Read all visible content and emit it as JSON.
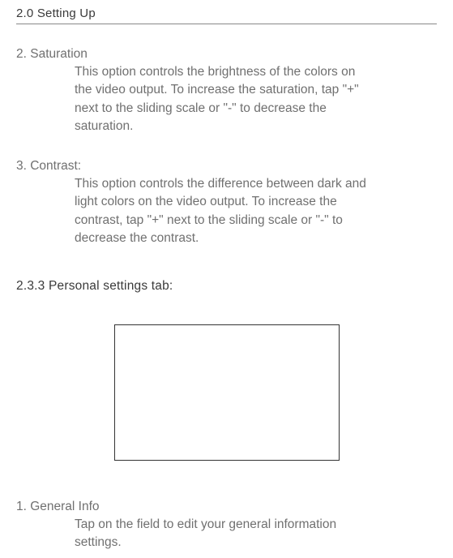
{
  "header": "2.0 Setting Up",
  "items": [
    {
      "title": "2. Saturation",
      "body": "This option controls the brightness of the colors on the video output.  To increase the saturation, tap \"+\" next to the sliding scale or \"-\" to decrease the saturation."
    },
    {
      "title": "3. Contrast:",
      "body": "This option controls the difference between dark and light colors on the video output.  To increase the contrast, tap \"+\" next to the sliding scale or \"-\" to decrease the contrast."
    }
  ],
  "subsection": "2.3.3 Personal settings tab:",
  "general": {
    "title": "1. General Info",
    "body": "Tap on the field to edit your general information settings."
  }
}
